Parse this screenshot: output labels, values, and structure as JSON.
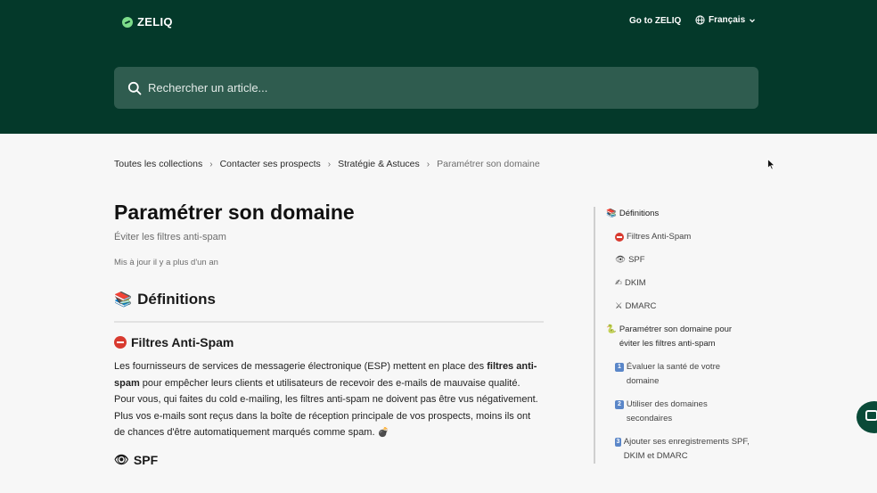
{
  "header": {
    "logo_text": "ZELIQ",
    "goto_label": "Go to ZELIQ",
    "language_label": "Français"
  },
  "search": {
    "placeholder": "Rechercher un article..."
  },
  "breadcrumb": [
    "Toutes les collections",
    "Contacter ses prospects",
    "Stratégie & Astuces",
    "Paramétrer son domaine"
  ],
  "breadcrumb_separator": "›",
  "article": {
    "title": "Paramétrer son domaine",
    "subtitle": "Éviter les filtres anti-spam",
    "updated": "Mis à jour il y a plus d'un an",
    "section_definitions_emoji": "📚",
    "section_definitions": "Définitions",
    "section_spam": "Filtres Anti-Spam",
    "para1_part1": "Les fournisseurs de services de messagerie électronique (ESP) mettent en place des ",
    "para1_bold": "filtres anti-spam",
    "para1_part2": " pour empêcher leurs clients et utilisateurs de recevoir des e-mails de mauvaise qualité.",
    "para2": "Pour vous, qui faites du cold e-mailing, les filtres anti-spam ne doivent pas être vus négativement. Plus vos e-mails sont reçus dans la boîte de réception principale de vos prospects, moins ils ont de chances d'être automatiquement marqués comme spam.",
    "para2_emoji": "💣",
    "section_spf_emoji": "👁",
    "section_spf": "SPF"
  },
  "toc": {
    "items": [
      {
        "emoji": "📚",
        "label": "Définitions"
      },
      {
        "label": "Filtres Anti-Spam"
      },
      {
        "emoji": "👁",
        "label": "SPF"
      },
      {
        "emoji": "✍",
        "label": "DKIM"
      },
      {
        "emoji": "⚔",
        "label": "DMARC"
      },
      {
        "emoji": "🐍",
        "label": "Paramétrer son domaine pour éviter les filtres anti-spam"
      },
      {
        "badge": "1",
        "label": "Évaluer la santé de votre domaine"
      },
      {
        "badge": "2",
        "label": "Utiliser des domaines secondaires"
      },
      {
        "badge": "3",
        "label": "Ajouter ses enregistrements SPF, DKIM et DMARC"
      }
    ]
  },
  "colors": {
    "header_bg": "#04392a",
    "search_bg": "#2f5c4f",
    "page_bg": "#f7f7f7"
  }
}
